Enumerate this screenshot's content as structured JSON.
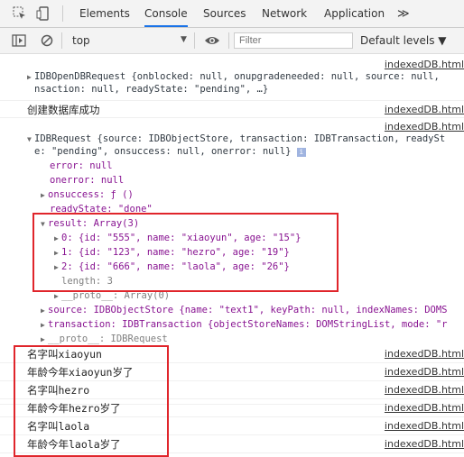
{
  "tabs": [
    {
      "label": "Elements"
    },
    {
      "label": "Console",
      "active": true
    },
    {
      "label": "Sources"
    },
    {
      "label": "Network"
    },
    {
      "label": "Application"
    }
  ],
  "more_tabs": "≫",
  "toolbar": {
    "context": "top",
    "filter_placeholder": "Filter",
    "levels": "Default levels ▼"
  },
  "source": "indexedDB.html",
  "log": {
    "openreq_1": "IDBOpenDBRequest {onblocked: null, onupgradeneeded: null, source: null,",
    "openreq_2": "nsaction: null, readyState: \"pending\", …}",
    "created": "创建数据库成功",
    "req_1": "IDBRequest {source: IDBObjectStore, transaction: IDBTransaction, readySt",
    "req_2": "e: \"pending\", onsuccess: null, onerror: null}",
    "error": "error: null",
    "onerror": "onerror: null",
    "onsuccess": "onsuccess: ƒ ()",
    "readyState": "readyState: \"done\"",
    "result": "result: Array(3)",
    "items": [
      "0: {id: \"555\", name: \"xiaoyun\", age: \"15\"}",
      "1: {id: \"123\", name: \"hezro\", age: \"19\"}",
      "2: {id: \"666\", name: \"laola\", age: \"26\"}"
    ],
    "length": "length: 3",
    "proto_arr": "__proto__: Array(0)",
    "source_line": "source: IDBObjectStore {name: \"text1\", keyPath: null, indexNames: DOMS",
    "transaction_line": "transaction: IDBTransaction {objectStoreNames: DOMStringList, mode: \"r",
    "proto_req": "__proto__: IDBRequest",
    "outputs": [
      "名字叫xiaoyun",
      "年龄今年xiaoyun岁了",
      "名字叫hezro",
      "年龄今年hezro岁了",
      "名字叫laola",
      "年龄今年laola岁了"
    ]
  },
  "colors": {
    "highlight": "#e0252b",
    "tab_active": "#1a73e8"
  }
}
